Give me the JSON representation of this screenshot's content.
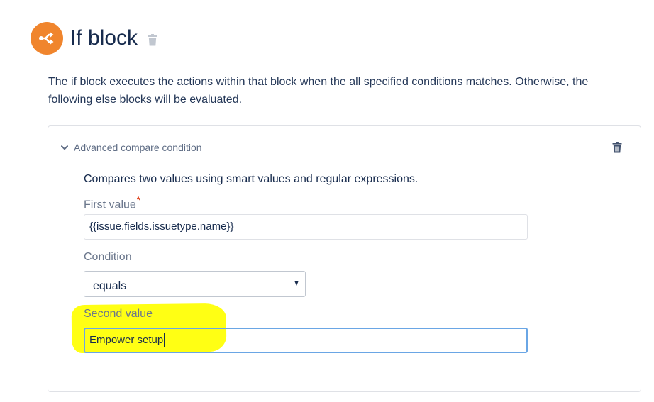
{
  "header": {
    "title": "If block",
    "icon": "branch-icon",
    "icon_color": "#f0852d",
    "delete_icon": "trash-icon"
  },
  "description": "The if block executes the actions within that block when the all specified conditions matches. Otherwise, the following else blocks will be evaluated.",
  "condition_card": {
    "title": "Advanced compare condition",
    "expand_icon": "chevron-down-icon",
    "delete_icon": "trash-icon",
    "intro": "Compares two values using smart values and regular expressions.",
    "first_value": {
      "label": "First value",
      "required_mark": "*",
      "value": "{{issue.fields.issuetype.name}}"
    },
    "condition": {
      "label": "Condition",
      "selected": "equals"
    },
    "second_value": {
      "label": "Second value",
      "value": "Empower setup"
    }
  },
  "colors": {
    "highlight": "#ffff00",
    "focus_border": "#6aa6e5",
    "required": "#de350b"
  }
}
